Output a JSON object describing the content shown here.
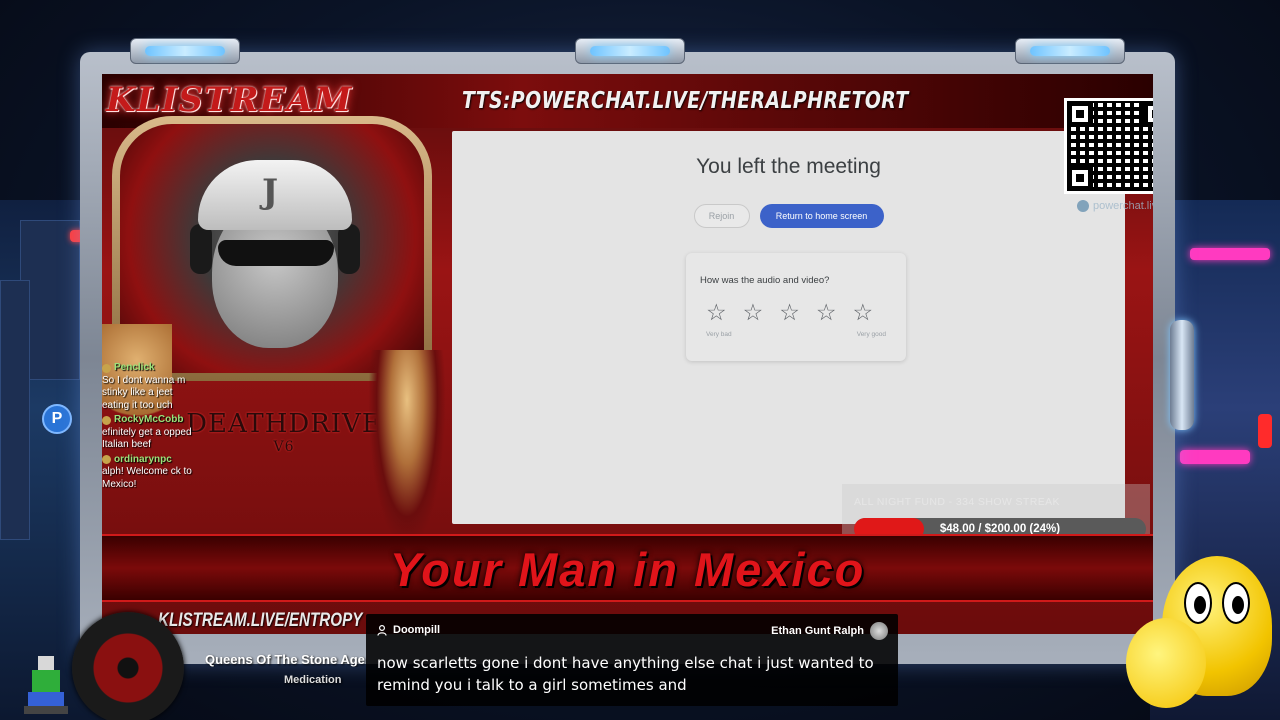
{
  "stream": {
    "logo_text": "KLISTREAM",
    "tts_url": "TTS:POWERCHAT.LIVE/THERALPHRETORT",
    "headline": "Your Man in Mexico",
    "tagline": "KLISTREAM.LIVE/ENTROPY",
    "portrait_badge": "DEATHDRIVE",
    "portrait_badge_sub": "V6"
  },
  "meeting": {
    "title": "You left the meeting",
    "rejoin_label": "Rejoin",
    "home_label": "Return to home screen",
    "feedback_question": "How was the audio and video?",
    "stars": [
      "☆",
      "☆",
      "☆",
      "☆",
      "☆"
    ],
    "rating_low_label": "Very bad",
    "rating_high_label": "Very good"
  },
  "powerchat": {
    "label": "powerchat.live"
  },
  "fund": {
    "title": "ALL NIGHT FUND - 334 SHOW STREAK",
    "amount_text": "$48.00 / $200.00 (24%)",
    "progress_fraction": 0.24,
    "fill_color": "#e01818"
  },
  "chat": {
    "messages": [
      {
        "user": "Penclick",
        "text": "So I dont wanna m stinky like a jeet eating it too uch"
      },
      {
        "user": "RockyMcCobb",
        "text": "efinitely get a opped Italian beef"
      },
      {
        "user": "ordinarynpc",
        "text": "alph! Welcome ck to Mexico!"
      }
    ]
  },
  "music": {
    "song_title": "Queens Of The Stone Age",
    "song_subtitle": "Medication"
  },
  "tts_message": {
    "sender": "Doompill",
    "target": "Ethan Gunt Ralph",
    "text": "now scarletts gone i dont have anything else chat i just wanted to remind you i talk to a girl sometimes and"
  },
  "icons": {
    "user": "user-icon",
    "star": "star-outline-icon",
    "p_badge": "P"
  }
}
